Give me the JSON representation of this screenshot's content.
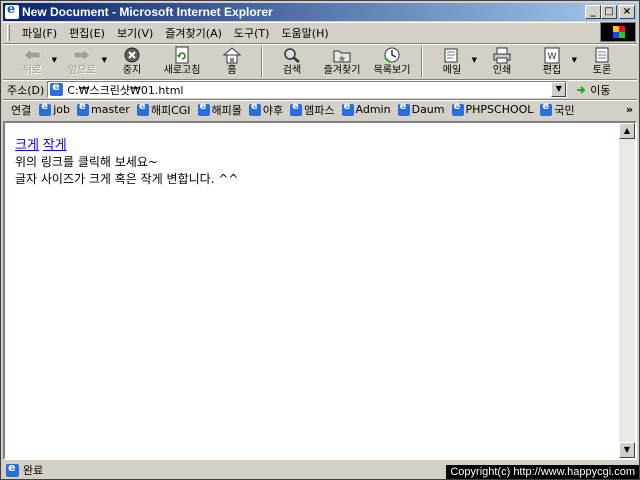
{
  "window": {
    "title": "New Document - Microsoft Internet Explorer"
  },
  "menu": [
    "파일(F)",
    "편집(E)",
    "보기(V)",
    "즐겨찾기(A)",
    "도구(T)",
    "도움말(H)"
  ],
  "toolbar": {
    "back": "뒤로",
    "forward": "앞으로",
    "stop": "중지",
    "refresh": "새로고침",
    "home": "홈",
    "search": "검색",
    "favorites": "즐겨찾기",
    "history": "목록보기",
    "mail": "메일",
    "print": "인쇄",
    "edit": "편집",
    "discuss": "토론"
  },
  "address": {
    "label": "주소(D)",
    "value": "C:₩스크린샷₩01.html",
    "go": "이동"
  },
  "links": {
    "caption": "연결",
    "items": [
      "job",
      "master",
      "해피CGI",
      "해피몰",
      "야후",
      "엠파스",
      "Admin",
      "Daum",
      "PHPSCHOOL",
      "국민"
    ],
    "more": "»"
  },
  "page": {
    "link_large": "크게",
    "link_small": "작게",
    "line1": "위의 링크를 클릭해 보세요~",
    "line2": "글자 사이즈가 크게 혹은 작게 변합니다. ^^"
  },
  "status": {
    "text": "완료"
  },
  "watermark": "Copyright(c) http://www.happycgi.com"
}
